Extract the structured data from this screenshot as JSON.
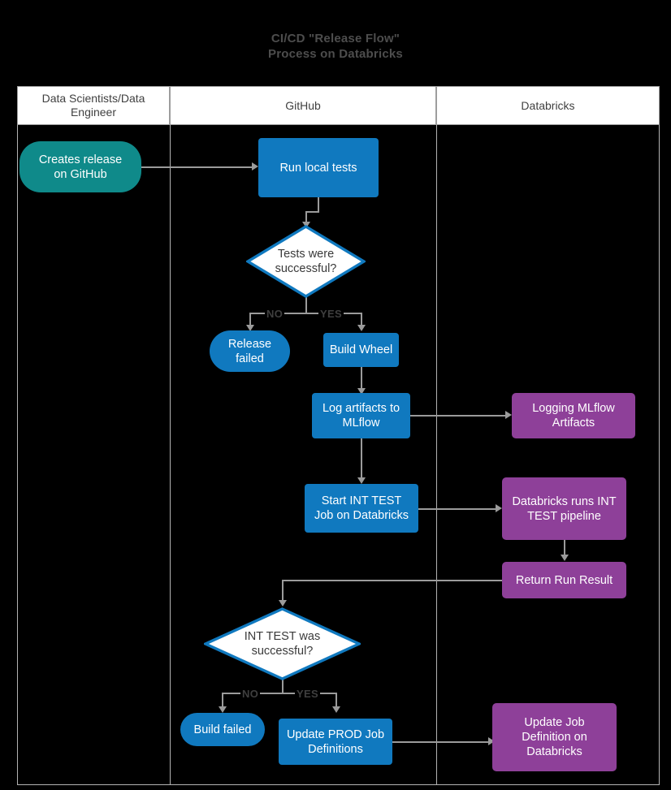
{
  "title": "CI/CD  \"Release Flow\"\nProcess on Databricks",
  "colors": {
    "background": "#000000",
    "blue": "#1079bf",
    "teal": "#0f8a8a",
    "purple": "#8e4099",
    "connector": "#9b9b9b",
    "lane_border": "#b3b3b3",
    "lane_header_bg": "#ffffff",
    "lane_header_text": "#404040",
    "title_text": "#4d4d4d",
    "diamond_fill": "#ffffff",
    "diamond_stroke": "#1079bf",
    "diamond_text": "#3a3a3a"
  },
  "lanes": [
    {
      "id": "lane-data-scientists",
      "label": "Data Scientists/Data Engineer"
    },
    {
      "id": "lane-github",
      "label": "GitHub"
    },
    {
      "id": "lane-databricks",
      "label": "Databricks"
    }
  ],
  "nodes": [
    {
      "id": "creates-release",
      "label": "Creates release\non GitHub",
      "shape": "pill",
      "color": "teal",
      "lane": "lane-data-scientists"
    },
    {
      "id": "run-local-tests",
      "label": "Run local tests",
      "shape": "rect",
      "color": "blue",
      "lane": "lane-github"
    },
    {
      "id": "tests-successful",
      "label": "Tests were\nsuccessful?",
      "shape": "diamond",
      "color": "blue",
      "lane": "lane-github"
    },
    {
      "id": "release-failed",
      "label": "Release\nfailed",
      "shape": "pill",
      "color": "blue",
      "lane": "lane-github"
    },
    {
      "id": "build-wheel",
      "label": "Build Wheel",
      "shape": "rect",
      "color": "blue",
      "lane": "lane-github"
    },
    {
      "id": "log-artifacts",
      "label": "Log artifacts to\nMLflow",
      "shape": "rect",
      "color": "blue",
      "lane": "lane-github"
    },
    {
      "id": "logging-mlflow",
      "label": "Logging MLflow\nArtifacts",
      "shape": "rect",
      "color": "purple",
      "lane": "lane-databricks"
    },
    {
      "id": "start-int-test",
      "label": "Start INT TEST\nJob on Databricks",
      "shape": "rect",
      "color": "blue",
      "lane": "lane-github"
    },
    {
      "id": "databricks-int-test",
      "label": "Databricks runs INT\nTEST pipeline",
      "shape": "rect",
      "color": "purple",
      "lane": "lane-databricks"
    },
    {
      "id": "return-run-result",
      "label": "Return Run Result",
      "shape": "rect",
      "color": "purple",
      "lane": "lane-databricks"
    },
    {
      "id": "int-test-successful",
      "label": "INT TEST was\nsuccessful?",
      "shape": "diamond",
      "color": "blue",
      "lane": "lane-github"
    },
    {
      "id": "build-failed",
      "label": "Build failed",
      "shape": "pill",
      "color": "blue",
      "lane": "lane-github"
    },
    {
      "id": "update-prod-job",
      "label": "Update PROD Job\nDefinitions",
      "shape": "rect",
      "color": "blue",
      "lane": "lane-github"
    },
    {
      "id": "update-job-definition",
      "label": "Update Job\nDefinition on\nDatabricks",
      "shape": "rect",
      "color": "purple",
      "lane": "lane-databricks"
    }
  ],
  "edge_labels": {
    "tests_no": "NO",
    "tests_yes": "YES",
    "int_no": "NO",
    "int_yes": "YES"
  }
}
